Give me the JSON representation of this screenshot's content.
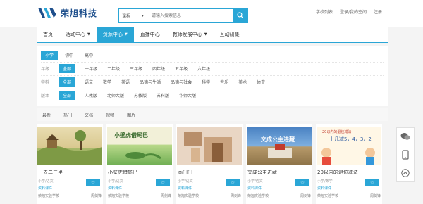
{
  "header": {
    "logo_text": "荣旭科技",
    "search": {
      "type_label": "课程",
      "placeholder": "请输入搜索信息"
    },
    "links": [
      "学校列表",
      "登录/我的空间",
      "注册"
    ]
  },
  "nav": {
    "items": [
      {
        "label": "首页",
        "dropdown": false,
        "active": false
      },
      {
        "label": "活动中心",
        "dropdown": true,
        "active": false
      },
      {
        "label": "资源中心",
        "dropdown": true,
        "active": true
      },
      {
        "label": "直播中心",
        "dropdown": false,
        "active": false
      },
      {
        "label": "教师发展中心",
        "dropdown": true,
        "active": false
      },
      {
        "label": "互动研集",
        "dropdown": false,
        "active": false
      }
    ]
  },
  "filters": {
    "levels": [
      "小学",
      "初中",
      "高中"
    ],
    "grade": {
      "label": "年级",
      "items": [
        "全部",
        "一年级",
        "二年级",
        "三年级",
        "四年级",
        "五年级",
        "六年级"
      ]
    },
    "subject": {
      "label": "学科",
      "items": [
        "全部",
        "语文",
        "数学",
        "英语",
        "品德与生活",
        "品德与社会",
        "科学",
        "音乐",
        "美术",
        "体育"
      ]
    },
    "version": {
      "label": "版本",
      "items": [
        "全部",
        "人教版",
        "北师大版",
        "苏教版",
        "苏科版",
        "华师大版"
      ]
    }
  },
  "tabs": [
    "最新",
    "热门",
    "文档",
    "视频",
    "图片"
  ],
  "cards": [
    {
      "title": "一去二三里",
      "meta": "小学/语文",
      "tag": "资料课件",
      "school": "荣旭实验学校",
      "author": "周剑锋"
    },
    {
      "title": "小壁虎借尾巴",
      "meta": "小学/语文",
      "tag": "资料课件",
      "school": "荣旭实验学校",
      "author": "周剑锋"
    },
    {
      "title": "画门门",
      "meta": "小学/语文",
      "tag": "资料课件",
      "school": "荣旭实验学校",
      "author": "周剑锋"
    },
    {
      "title": "文成公主进藏",
      "meta": "小学/语文",
      "tag": "资料课件",
      "school": "荣旭实验学校",
      "author": "周剑锋"
    },
    {
      "title": "20以内的退位减法",
      "meta": "小学/数学",
      "tag": "资料课件",
      "school": "荣旭实验学校",
      "author": "周剑锋"
    }
  ],
  "thumb_texts": {
    "card2": "小壁虎借尾巴",
    "card4": "文成公主进藏",
    "card5_title": "20以内的退位减法",
    "card5_numbers": "十几减5，4，3，2"
  },
  "colors": {
    "accent": "#2aa6d6",
    "brand": "#1e4f8c"
  }
}
